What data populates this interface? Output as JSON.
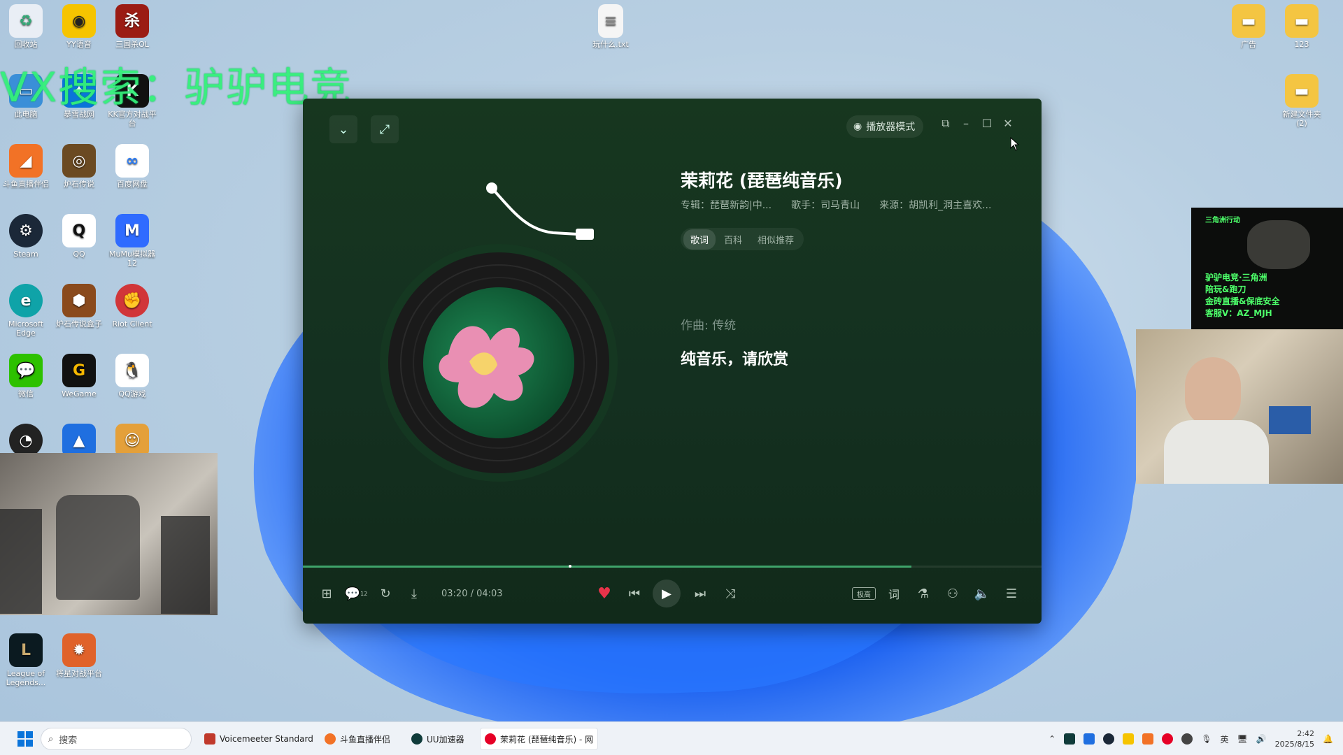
{
  "overlay_text": "VX搜索：驴驴电竞",
  "desktop": {
    "icons": [
      {
        "label": "回收站"
      },
      {
        "label": "YY语音"
      },
      {
        "label": "三国杀OL"
      },
      {
        "label": "此电脑"
      },
      {
        "label": "暴雪战网"
      },
      {
        "label": "KK官方对战平台"
      },
      {
        "label": "斗鱼直播伴侣"
      },
      {
        "label": "炉石传说"
      },
      {
        "label": "百度网盘"
      },
      {
        "label": "Steam"
      },
      {
        "label": "QQ"
      },
      {
        "label": "MuMu模拟器12"
      },
      {
        "label": "Microsoft Edge"
      },
      {
        "label": "炉石传说盒子"
      },
      {
        "label": "Riot Client"
      },
      {
        "label": "微信"
      },
      {
        "label": "WeGame"
      },
      {
        "label": "QQ游戏"
      },
      {
        "label": "League of Legends..."
      },
      {
        "label": "将星对战平台"
      },
      {
        "label": "玩什么.txt"
      },
      {
        "label": "广告"
      },
      {
        "label": "123"
      },
      {
        "label": "新建文件夹 (2)"
      }
    ]
  },
  "promo": {
    "brand": "三角洲行动",
    "lines": [
      "驴驴电竞·三角洲",
      "陪玩&跑刀",
      "金砖直播&保底安全",
      "客服V：AZ_MJH"
    ]
  },
  "player": {
    "mode_button": "播放器模式",
    "song_title": "茉莉花 (琵琶纯音乐)",
    "meta": {
      "album": "专辑：琵琶新韵|中...",
      "artist": "歌手：司马青山",
      "source": "来源：胡凯利_洞主喜欢..."
    },
    "tabs": [
      {
        "label": "歌词",
        "active": true
      },
      {
        "label": "百科",
        "active": false
      },
      {
        "label": "相似推荐",
        "active": false
      }
    ],
    "lyrics": [
      "作曲: 传统",
      "纯音乐，请欣赏"
    ],
    "time": "03:20 / 04:03",
    "progress": 0.8235,
    "quality_badge": "极高",
    "lyrics_button": "词",
    "comment_badge": "12",
    "accent": "#3fa36a",
    "like_color": "#e8334a"
  },
  "taskbar": {
    "search_placeholder": "搜索",
    "apps": [
      {
        "label": "Voicemeeter Standard"
      },
      {
        "label": "斗鱼直播伴侣"
      },
      {
        "label": "UU加速器"
      },
      {
        "label": "茉莉花 (琵琶纯音乐) - 网"
      }
    ],
    "ime": "英",
    "time": "2:42",
    "date": "2025/8/15"
  }
}
